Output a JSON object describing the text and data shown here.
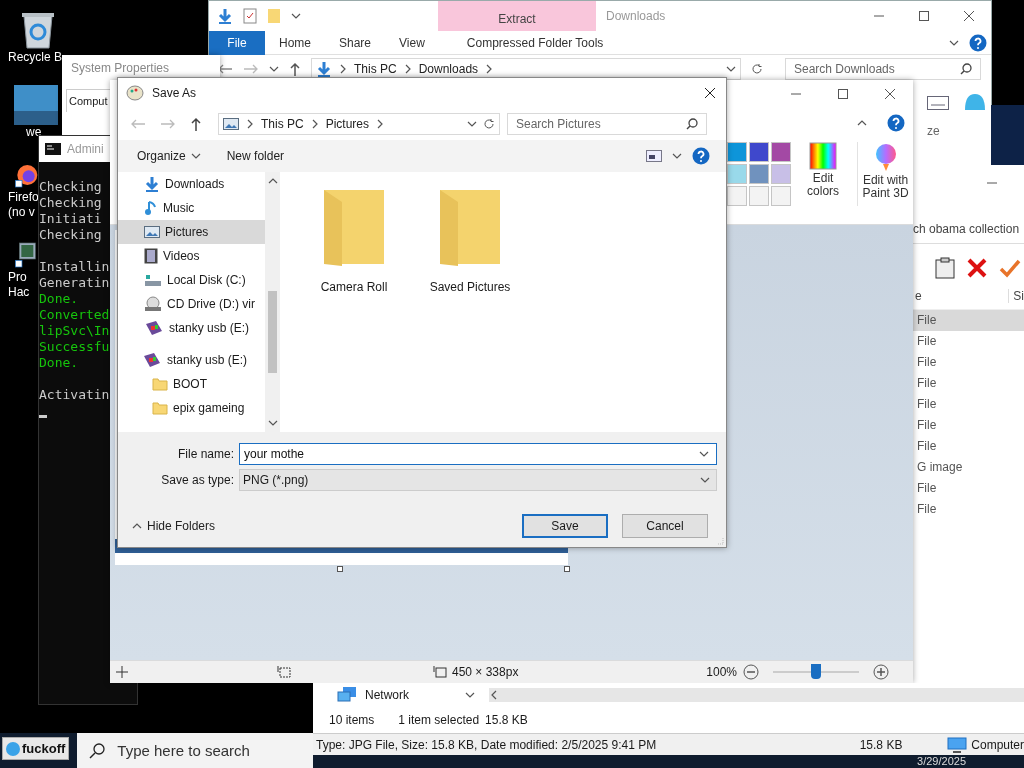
{
  "desktop_icons": [
    {
      "lines": [
        "Recycle B"
      ]
    },
    {
      "lines": [
        "we"
      ]
    },
    {
      "lines": [
        "Firefo",
        "(no v"
      ]
    },
    {
      "lines": [
        "Pro",
        "Hac"
      ]
    }
  ],
  "explorer": {
    "context_tab": "Extract",
    "title": "Downloads",
    "tabs": [
      {
        "label": "File",
        "selected": true
      },
      {
        "label": "Home",
        "selected": false
      },
      {
        "label": "Share",
        "selected": false
      },
      {
        "label": "View",
        "selected": false
      },
      {
        "label": "Compressed Folder Tools",
        "selected": false
      }
    ],
    "breadcrumb": [
      "This PC",
      "Downloads"
    ],
    "search": {
      "placeholder": "Search Downloads"
    }
  },
  "system_properties": {
    "title": "System Properties",
    "tab": "Comput"
  },
  "console": {
    "title": "Admini",
    "lines": [
      {
        "text": "Checking",
        "color": "#cccccc"
      },
      {
        "text": "Checking",
        "color": "#cccccc"
      },
      {
        "text": "Initiati",
        "color": "#cccccc"
      },
      {
        "text": "Checking",
        "color": "#cccccc"
      },
      {
        "text": "Installin",
        "color": "#cccccc"
      },
      {
        "text": "Generatin",
        "color": "#cccccc"
      },
      {
        "text": "Done.",
        "color": "#16c60c"
      },
      {
        "text": "Converted",
        "color": "#16c60c"
      },
      {
        "text": "lipSvc\\In",
        "color": "#16c60c"
      },
      {
        "text": "Successfu",
        "color": "#16c60c"
      },
      {
        "text": "Done.",
        "color": "#16c60c"
      },
      {
        "text": "Activatin",
        "color": "#cccccc"
      }
    ]
  },
  "side_fragment": {
    "header": "ze"
  },
  "collection_window": {
    "search": "ch obama collection",
    "columns": [
      "e",
      "Si"
    ],
    "rows": [
      {
        "text": "File",
        "selected": true
      },
      {
        "text": "File",
        "selected": false
      },
      {
        "text": "File",
        "selected": false
      },
      {
        "text": "File",
        "selected": false
      },
      {
        "text": "File",
        "selected": false
      },
      {
        "text": "File",
        "selected": false
      },
      {
        "text": "File",
        "selected": false
      },
      {
        "text": "G image",
        "selected": false
      },
      {
        "text": "File",
        "selected": false
      },
      {
        "text": "File",
        "selected": false
      }
    ]
  },
  "paint": {
    "palette": [
      {
        "color": "#0e95d9"
      },
      {
        "color": "#3f48cc"
      },
      {
        "color": "#a349a4"
      },
      {
        "color": "#99d9ea"
      },
      {
        "color": "#7092be"
      },
      {
        "color": "#c8bfe7"
      },
      {
        "color": "#f3f3f3"
      },
      {
        "color": "#f3f3f3"
      },
      {
        "color": "#f3f3f3"
      }
    ],
    "edit_colors": "Edit colors",
    "paint3d": "Edit with Paint 3D",
    "size": "450 × 338px",
    "zoom": "100%",
    "zoom_slider": {
      "level": 0.5
    }
  },
  "save_as": {
    "title": "Save As",
    "breadcrumb": [
      "This PC",
      "Pictures"
    ],
    "search": {
      "placeholder": "Search Pictures"
    },
    "organize": "Organize",
    "new_folder": "New folder",
    "nav": [
      {
        "label": "Downloads",
        "selected": false
      },
      {
        "label": "Music",
        "selected": false
      },
      {
        "label": "Pictures",
        "selected": true
      },
      {
        "label": "Videos",
        "selected": false
      },
      {
        "label": "Local Disk (C:)",
        "selected": false
      },
      {
        "label": "CD Drive (D:) vir",
        "selected": false
      },
      {
        "label": "stanky usb (E:)",
        "selected": false
      },
      {
        "label": "stanky usb (E:)",
        "selected": false,
        "children": [
          {
            "label": "BOOT",
            "selected": false
          },
          {
            "label": "epix gameing",
            "selected": false
          }
        ]
      }
    ],
    "folders": [
      "Camera Roll",
      "Saved Pictures"
    ],
    "file_name_label": "File name:",
    "file_name": "your mothe",
    "type_label": "Save as type:",
    "type_value": "PNG (*.png)",
    "hide_folders": "Hide Folders",
    "save": "Save",
    "cancel": "Cancel"
  },
  "file_window": {
    "nav_item": "Network",
    "status": [
      "10 items",
      "1 item selected",
      "15.8 KB"
    ],
    "details": "Type: JPG File, Size: 15.8 KB, Date modified: 2/5/2025 9:41 PM",
    "details_size": "15.8 KB",
    "location": "Computer"
  },
  "taskbar": {
    "start_label": "fuckoff",
    "search": {
      "placeholder": "Type here to search"
    },
    "date": "3/29/2025"
  }
}
